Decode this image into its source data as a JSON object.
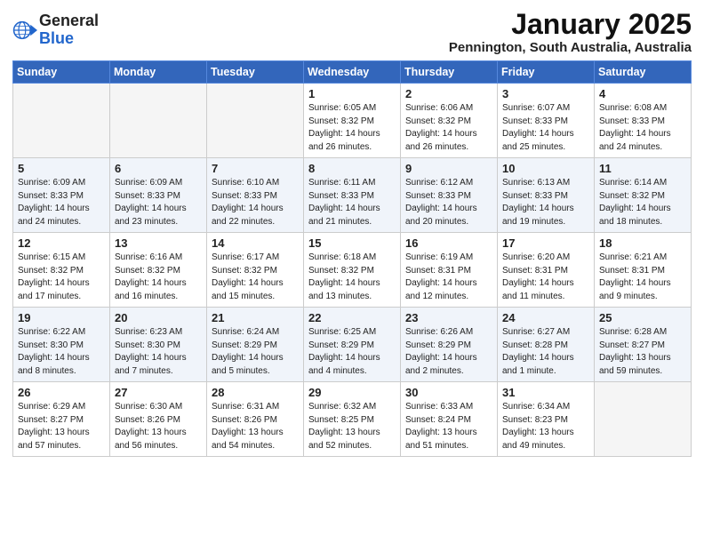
{
  "logo": {
    "general": "General",
    "blue": "Blue"
  },
  "header": {
    "month": "January 2025",
    "location": "Pennington, South Australia, Australia"
  },
  "weekdays": [
    "Sunday",
    "Monday",
    "Tuesday",
    "Wednesday",
    "Thursday",
    "Friday",
    "Saturday"
  ],
  "weeks": [
    [
      {
        "day": "",
        "info": ""
      },
      {
        "day": "",
        "info": ""
      },
      {
        "day": "",
        "info": ""
      },
      {
        "day": "1",
        "info": "Sunrise: 6:05 AM\nSunset: 8:32 PM\nDaylight: 14 hours\nand 26 minutes."
      },
      {
        "day": "2",
        "info": "Sunrise: 6:06 AM\nSunset: 8:32 PM\nDaylight: 14 hours\nand 26 minutes."
      },
      {
        "day": "3",
        "info": "Sunrise: 6:07 AM\nSunset: 8:33 PM\nDaylight: 14 hours\nand 25 minutes."
      },
      {
        "day": "4",
        "info": "Sunrise: 6:08 AM\nSunset: 8:33 PM\nDaylight: 14 hours\nand 24 minutes."
      }
    ],
    [
      {
        "day": "5",
        "info": "Sunrise: 6:09 AM\nSunset: 8:33 PM\nDaylight: 14 hours\nand 24 minutes."
      },
      {
        "day": "6",
        "info": "Sunrise: 6:09 AM\nSunset: 8:33 PM\nDaylight: 14 hours\nand 23 minutes."
      },
      {
        "day": "7",
        "info": "Sunrise: 6:10 AM\nSunset: 8:33 PM\nDaylight: 14 hours\nand 22 minutes."
      },
      {
        "day": "8",
        "info": "Sunrise: 6:11 AM\nSunset: 8:33 PM\nDaylight: 14 hours\nand 21 minutes."
      },
      {
        "day": "9",
        "info": "Sunrise: 6:12 AM\nSunset: 8:33 PM\nDaylight: 14 hours\nand 20 minutes."
      },
      {
        "day": "10",
        "info": "Sunrise: 6:13 AM\nSunset: 8:33 PM\nDaylight: 14 hours\nand 19 minutes."
      },
      {
        "day": "11",
        "info": "Sunrise: 6:14 AM\nSunset: 8:32 PM\nDaylight: 14 hours\nand 18 minutes."
      }
    ],
    [
      {
        "day": "12",
        "info": "Sunrise: 6:15 AM\nSunset: 8:32 PM\nDaylight: 14 hours\nand 17 minutes."
      },
      {
        "day": "13",
        "info": "Sunrise: 6:16 AM\nSunset: 8:32 PM\nDaylight: 14 hours\nand 16 minutes."
      },
      {
        "day": "14",
        "info": "Sunrise: 6:17 AM\nSunset: 8:32 PM\nDaylight: 14 hours\nand 15 minutes."
      },
      {
        "day": "15",
        "info": "Sunrise: 6:18 AM\nSunset: 8:32 PM\nDaylight: 14 hours\nand 13 minutes."
      },
      {
        "day": "16",
        "info": "Sunrise: 6:19 AM\nSunset: 8:31 PM\nDaylight: 14 hours\nand 12 minutes."
      },
      {
        "day": "17",
        "info": "Sunrise: 6:20 AM\nSunset: 8:31 PM\nDaylight: 14 hours\nand 11 minutes."
      },
      {
        "day": "18",
        "info": "Sunrise: 6:21 AM\nSunset: 8:31 PM\nDaylight: 14 hours\nand 9 minutes."
      }
    ],
    [
      {
        "day": "19",
        "info": "Sunrise: 6:22 AM\nSunset: 8:30 PM\nDaylight: 14 hours\nand 8 minutes."
      },
      {
        "day": "20",
        "info": "Sunrise: 6:23 AM\nSunset: 8:30 PM\nDaylight: 14 hours\nand 7 minutes."
      },
      {
        "day": "21",
        "info": "Sunrise: 6:24 AM\nSunset: 8:29 PM\nDaylight: 14 hours\nand 5 minutes."
      },
      {
        "day": "22",
        "info": "Sunrise: 6:25 AM\nSunset: 8:29 PM\nDaylight: 14 hours\nand 4 minutes."
      },
      {
        "day": "23",
        "info": "Sunrise: 6:26 AM\nSunset: 8:29 PM\nDaylight: 14 hours\nand 2 minutes."
      },
      {
        "day": "24",
        "info": "Sunrise: 6:27 AM\nSunset: 8:28 PM\nDaylight: 14 hours\nand 1 minute."
      },
      {
        "day": "25",
        "info": "Sunrise: 6:28 AM\nSunset: 8:27 PM\nDaylight: 13 hours\nand 59 minutes."
      }
    ],
    [
      {
        "day": "26",
        "info": "Sunrise: 6:29 AM\nSunset: 8:27 PM\nDaylight: 13 hours\nand 57 minutes."
      },
      {
        "day": "27",
        "info": "Sunrise: 6:30 AM\nSunset: 8:26 PM\nDaylight: 13 hours\nand 56 minutes."
      },
      {
        "day": "28",
        "info": "Sunrise: 6:31 AM\nSunset: 8:26 PM\nDaylight: 13 hours\nand 54 minutes."
      },
      {
        "day": "29",
        "info": "Sunrise: 6:32 AM\nSunset: 8:25 PM\nDaylight: 13 hours\nand 52 minutes."
      },
      {
        "day": "30",
        "info": "Sunrise: 6:33 AM\nSunset: 8:24 PM\nDaylight: 13 hours\nand 51 minutes."
      },
      {
        "day": "31",
        "info": "Sunrise: 6:34 AM\nSunset: 8:23 PM\nDaylight: 13 hours\nand 49 minutes."
      },
      {
        "day": "",
        "info": ""
      }
    ]
  ]
}
